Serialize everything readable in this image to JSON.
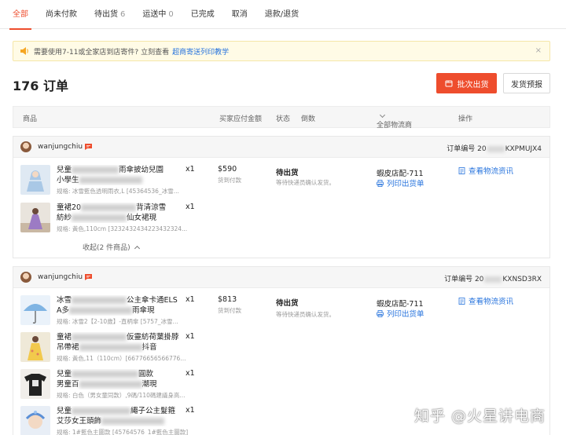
{
  "tabs": [
    {
      "label": "全部",
      "count": ""
    },
    {
      "label": "尚未付款",
      "count": ""
    },
    {
      "label": "待出货",
      "count": "6"
    },
    {
      "label": "运送中",
      "count": "0"
    },
    {
      "label": "已完成",
      "count": ""
    },
    {
      "label": "取消",
      "count": ""
    },
    {
      "label": "退款/退货",
      "count": ""
    }
  ],
  "notice": {
    "text": "需要使用7-11或全家店到店寄件? 立刻查看",
    "link": "超商寄送列印教学",
    "close": "×"
  },
  "header": {
    "order_count": "176 订单",
    "batch_ship": "批次出货",
    "ship_forecast": "发货预报"
  },
  "columns": {
    "product": "商品",
    "buyer_amount": "买家应付金额",
    "status": "状态",
    "countdown": "倒数",
    "carrier": "全部物流商",
    "action": "操作"
  },
  "orders": [
    {
      "username": "wanjungchiu",
      "order_label": "订单编号",
      "order_no_prefix": "20",
      "order_no_suffix": "KXPMUJX4",
      "amount": "$590",
      "payment": "货到付款",
      "status": "待出货",
      "sub_status": "等待快递员确认发货。",
      "carrier": "蝦皮店配-711",
      "print_label": "列印出货单",
      "action_label": "查看物流资讯",
      "collapse_label": "收起(2 件商品)",
      "items": [
        {
          "name_a": "兒童",
          "name_b": "雨傘披幼兒園",
          "name_c": "小學生",
          "name_d": "",
          "qty": "x1",
          "spec": "规格: 冰雪藍色透明雨衣,L [45364536_冰雪..."
        },
        {
          "name_a": "童裙20",
          "name_b": "背清涼雪",
          "name_c": "紡紗",
          "name_d": "仙女裙現",
          "qty": "x1",
          "spec": "规格: 黃色,110cm [3232432434223432324..."
        }
      ]
    },
    {
      "username": "wanjungchiu",
      "order_label": "订单编号",
      "order_no_prefix": "20",
      "order_no_suffix": "KXNSD3RX",
      "amount": "$813",
      "payment": "货到付款",
      "status": "待出货",
      "sub_status": "等待快递员确认发货。",
      "carrier": "蝦皮店配-711",
      "print_label": "列印出货单",
      "action_label": "查看物流资讯",
      "collapse_label": "",
      "items": [
        {
          "name_a": "冰雪",
          "name_b": "公主傘卡通ELS",
          "name_c": "A多",
          "name_d": "雨傘現",
          "qty": "x1",
          "spec": "规格: 冰雪2【2-10歲】-直柄傘 [5757_冰雪..."
        },
        {
          "name_a": "童裙",
          "name_b": "仮靈紡荷葉掛脖",
          "name_c": "吊帶裙",
          "name_d": "抖音",
          "qty": "x1",
          "spec": "规格: 黃色,11（110cm）[66776656566776..."
        },
        {
          "name_a": "兒童",
          "name_b": "圓款",
          "name_c": "男童百",
          "name_d": "潮現",
          "qty": "x1",
          "spec": "规格: 白色（男女童同款）,9碼/110碼建議身高..."
        },
        {
          "name_a": "兒童",
          "name_b": "繩子公主髮箍",
          "name_c": "艾莎女王頭飾",
          "name_d": "",
          "qty": "x1",
          "spec": "规格: 1#藍色主圖款 [45764576_1#藍色主圖款]"
        }
      ]
    }
  ],
  "watermark": "知乎 @火星讲电商",
  "colors": {
    "accent": "#ee4d2d",
    "link": "#2673dd",
    "notice_bg": "#fffbe6"
  }
}
